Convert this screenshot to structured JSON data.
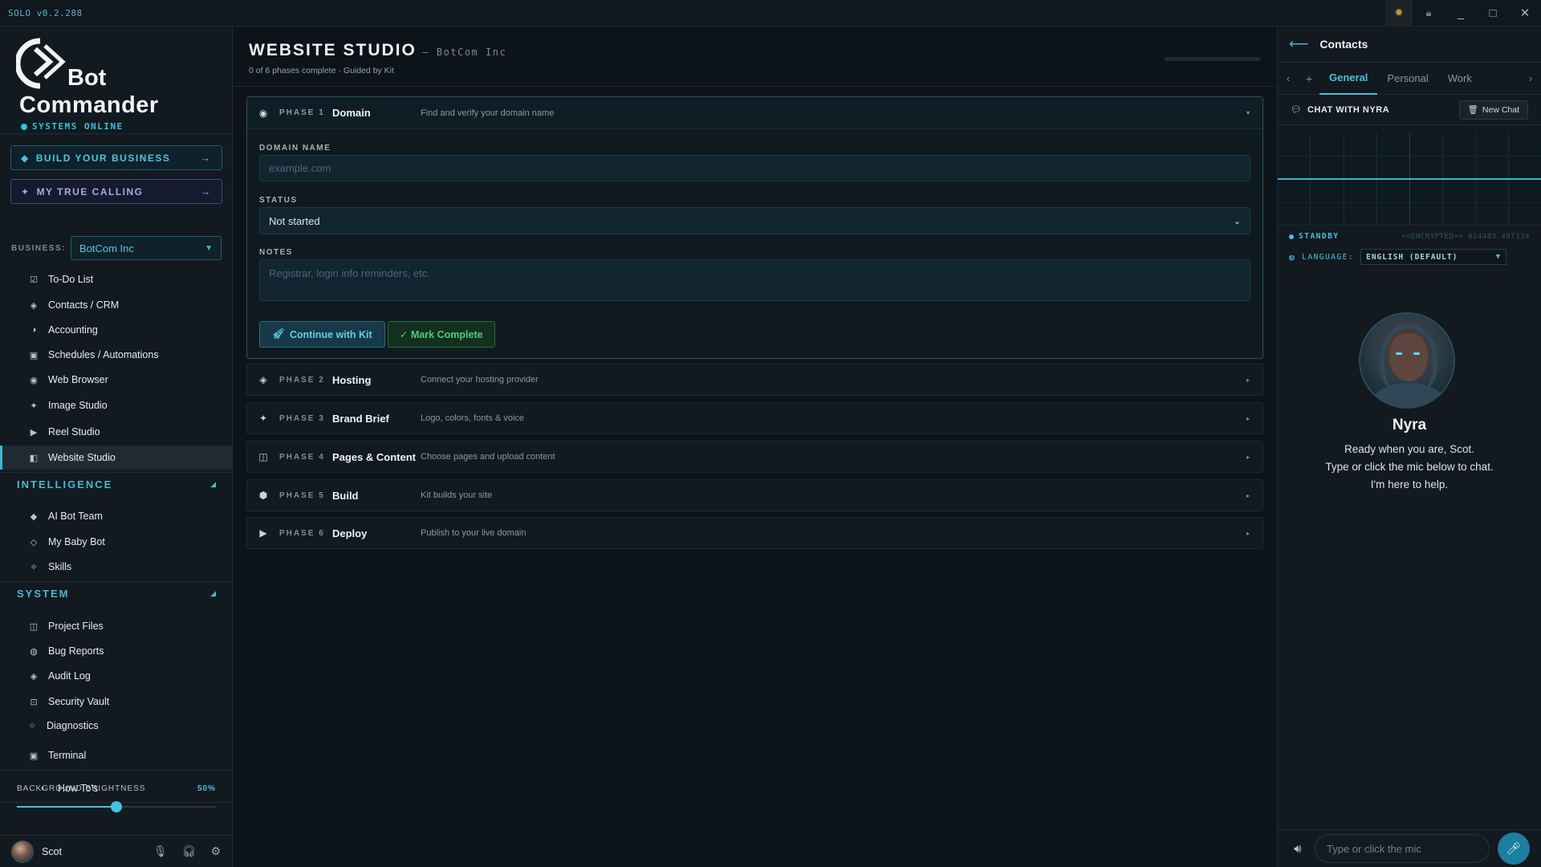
{
  "window": {
    "app_name": "SOLO v0.2.288",
    "controls": {
      "minimize": "_",
      "maximize": "□",
      "close": "✕"
    }
  },
  "brand": {
    "line1": "Bot",
    "line2": "Commander",
    "status": "SYSTEMS ONLINE"
  },
  "sidebar": {
    "cta_build": "BUILD YOUR BUSINESS",
    "cta_calling": "MY TRUE CALLING",
    "business_label": "BUSINESS:",
    "business_value": "BotCom Inc",
    "items": [
      {
        "label": "To-Do List",
        "icon": "checkbox-icon"
      },
      {
        "label": "Contacts / CRM",
        "icon": "diamond-icon"
      },
      {
        "label": "Accounting",
        "icon": "half-circle-icon"
      },
      {
        "label": "Schedules / Automations",
        "icon": "square-icon"
      },
      {
        "label": "Web Browser",
        "icon": "globe-icon"
      },
      {
        "label": "Image Studio",
        "icon": "sparkle-icon"
      },
      {
        "label": "Reel Studio",
        "icon": "play-icon"
      },
      {
        "label": "Website Studio",
        "icon": "layout-icon",
        "active": true
      }
    ],
    "intelligence": {
      "title": "INTELLIGENCE",
      "items": [
        {
          "label": "AI Bot Team",
          "icon": "diamond-icon"
        },
        {
          "label": "My Baby Bot",
          "icon": "diamond-outline-icon"
        },
        {
          "label": "Skills",
          "icon": "star-icon"
        }
      ]
    },
    "system": {
      "title": "SYSTEM",
      "items": [
        {
          "label": "Project Files",
          "icon": "folder-icon"
        },
        {
          "label": "Bug Reports",
          "icon": "bug-icon"
        },
        {
          "label": "Audit Log",
          "icon": "diamond-icon"
        },
        {
          "label": "Security Vault",
          "icon": "vault-icon"
        },
        {
          "label": "Diagnostics",
          "icon": "circle-icon"
        },
        {
          "label": "Terminal",
          "icon": "terminal-icon"
        },
        {
          "label": "How To's",
          "icon": "half-circle-icon"
        }
      ]
    },
    "brightness": {
      "label": "BACKGROUND BRIGHTNESS",
      "value_text": "50%",
      "value": 0.5
    },
    "user": {
      "name": "Scot"
    }
  },
  "main": {
    "title": "WEBSITE STUDIO",
    "company": "— BotCom Inc",
    "subtitle": "0 of 6 phases complete · Guided by Kit",
    "phases": [
      {
        "num": "PHASE 1",
        "name": "Domain",
        "desc": "Find and verify your domain name",
        "icon": "radio-icon",
        "expanded": true
      },
      {
        "num": "PHASE 2",
        "name": "Hosting",
        "desc": "Connect your hosting provider",
        "icon": "diamond-icon"
      },
      {
        "num": "PHASE 3",
        "name": "Brand Brief",
        "desc": "Logo, colors, fonts & voice",
        "icon": "sparkle-icon"
      },
      {
        "num": "PHASE 4",
        "name": "Pages & Content",
        "desc": "Choose pages and upload content",
        "icon": "book-icon"
      },
      {
        "num": "PHASE 5",
        "name": "Build",
        "desc": "Kit builds your site",
        "icon": "hexagon-icon"
      },
      {
        "num": "PHASE 6",
        "name": "Deploy",
        "desc": "Publish to your live domain",
        "icon": "play-icon"
      }
    ],
    "form": {
      "domain_label": "DOMAIN NAME",
      "domain_placeholder": "example.com",
      "status_label": "STATUS",
      "status_value": "Not started",
      "notes_label": "NOTES",
      "notes_placeholder": "Registrar, login info reminders, etc.",
      "continue_button": "Continue with Kit",
      "complete_button": "✓ Mark Complete"
    }
  },
  "right_panel": {
    "title": "Contacts",
    "tabs": [
      "General",
      "Personal",
      "Work"
    ],
    "active_tab": "General",
    "chat_label": "CHAT WITH NYRA",
    "new_chat": "New Chat",
    "standby": "STANDBY",
    "encrypted": "<<ENCRYPTED>> 024483.487134",
    "language_label": "LANGUAGE:",
    "language_value": "ENGLISH (DEFAULT)",
    "assistant_name": "Nyra",
    "message_lines": [
      "Ready when you are, Scot.",
      "Type or click the mic below to chat.",
      "I'm here to help."
    ],
    "input_placeholder": "Type or click the mic"
  },
  "colors": {
    "accent": "#3fc4e0",
    "success": "#43d07a",
    "purple": "#a9a6f0",
    "background": "#0d1419"
  }
}
